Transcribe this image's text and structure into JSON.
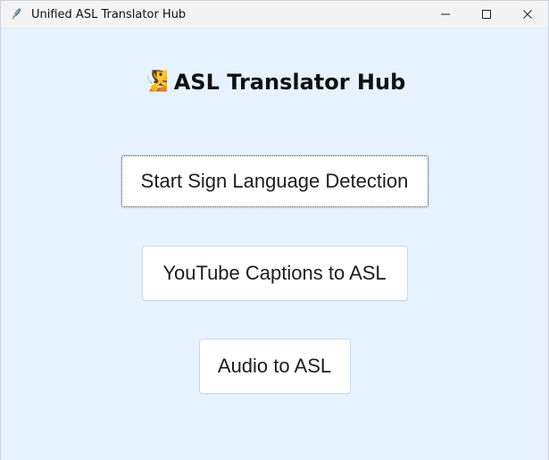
{
  "window": {
    "title": "Unified ASL Translator Hub",
    "icon": "feather-icon"
  },
  "controls": {
    "minimize": "minimize-icon",
    "maximize": "maximize-icon",
    "close": "close-icon"
  },
  "header": {
    "emoji": "🧏",
    "title": "ASL Translator Hub"
  },
  "buttons": {
    "detect": "Start Sign Language Detection",
    "youtube": "YouTube Captions to ASL",
    "audio": "Audio to ASL"
  },
  "colors": {
    "background": "#e6f3ff",
    "titlebar": "#f3f3f3",
    "button": "#ffffff"
  }
}
